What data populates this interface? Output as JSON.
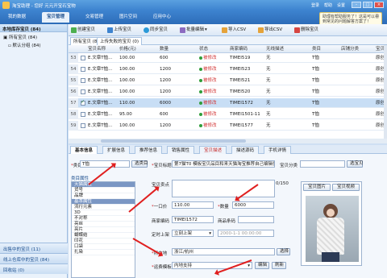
{
  "window": {
    "title": "淘宝助理 - 您好 元元开宝石宝物",
    "top_links": [
      "登录",
      "帮助",
      "设置"
    ]
  },
  "nav": {
    "tabs": [
      "我的数据",
      "宝贝管理",
      "交易管理",
      "图片空间",
      "应用中心"
    ],
    "active": 1
  },
  "sidebar": {
    "header": "本地库存宝贝 (84)",
    "items": [
      "所有宝贝 (84)",
      "默认分组 (84)"
    ],
    "footer": [
      "出售中的宝贝 (11)",
      "线上仓库中的宝贝 (84)",
      "回收站 (0)"
    ]
  },
  "toolbar": {
    "buttons": [
      "创建宝贝",
      "上传宝贝",
      "同步宝贝",
      "批量编辑",
      "导入CSV",
      "导出CSV",
      "删除宝贝"
    ]
  },
  "subtabs": [
    "所有宝贝 (84)",
    "上传失败的宝贝 (0)"
  ],
  "grid": {
    "columns": [
      "宝贝名称",
      "价格(元)",
      "数量",
      "状态",
      "商家编码",
      "无线描述",
      "类目",
      "店铺分类",
      "宝贝"
    ],
    "rows": [
      {
        "num": "53",
        "name": "E.文章T恤...",
        "price": "100.00",
        "qty": "600",
        "status": "被修改",
        "code": "TIMEI519",
        "wireless": "无",
        "cat": "T恤",
        "shopcat": "",
        "last": "原创",
        "checked": false,
        "selected": false
      },
      {
        "num": "54",
        "name": "E.文章T恤...",
        "price": "100.00",
        "qty": "1200",
        "status": "被修改",
        "code": "TIMEI523",
        "wireless": "无",
        "cat": "T恤",
        "shopcat": "",
        "last": "原创",
        "checked": false,
        "selected": false
      },
      {
        "num": "55",
        "name": "E.文章T恤...",
        "price": "100.00",
        "qty": "1200",
        "status": "被修改",
        "code": "TIMEI521",
        "wireless": "无",
        "cat": "T恤",
        "shopcat": "",
        "last": "原创",
        "checked": false,
        "selected": false
      },
      {
        "num": "56",
        "name": "E.文章T恤...",
        "price": "100.00",
        "qty": "1200",
        "status": "被修改",
        "code": "TIMEI520",
        "wireless": "无",
        "cat": "T恤",
        "shopcat": "",
        "last": "原创",
        "checked": false,
        "selected": false
      },
      {
        "num": "57",
        "name": "E.文章T恤...",
        "price": "110.00",
        "qty": "6000",
        "status": "被修改",
        "code": "TIMEI1572",
        "wireless": "无",
        "cat": "T恤",
        "shopcat": "",
        "last": "原创",
        "checked": true,
        "selected": true
      },
      {
        "num": "58",
        "name": "E.文章T恤...",
        "price": "95.00",
        "qty": "600",
        "status": "被修改",
        "code": "TIMEI1501-11",
        "wireless": "无",
        "cat": "T恤",
        "shopcat": "",
        "last": "原创",
        "checked": false,
        "selected": false
      },
      {
        "num": "59",
        "name": "E.文章T恤...",
        "price": "100.00",
        "qty": "1200",
        "status": "被修改",
        "code": "TIMEI1577",
        "wireless": "无",
        "cat": "T恤",
        "shopcat": "",
        "last": "原创",
        "checked": false,
        "selected": false
      }
    ]
  },
  "detail_tabs": [
    "基本信息",
    "扩展信息",
    "推荐信息",
    "销售属性",
    "宝贝描述",
    "描述源码",
    "手机详情"
  ],
  "detail": {
    "type_label": "类目",
    "type_value": "T恤",
    "select_btn": "选类目",
    "title_label": "宝贝标题",
    "title_value": "第7猫T0 模板宝贝品目和来天猫淘宝推荐自己编辑优化 51/60",
    "shopcat_label": "宝贝分类",
    "shopcat_btn": "选宝贝",
    "attr_header": "类目属性",
    "attr_items": [
      "天猫属性",
      "货号",
      "品牌",
      "基本属性",
      "流行元素",
      "3D",
      "不对称",
      "亮丝",
      "亮片",
      "蝴蝶结",
      "印花",
      "口袋",
      "扎染"
    ],
    "sellpoint_label": "宝贝卖点",
    "sellpoint_count": "0/150",
    "price_label": "一口价",
    "price_value": "110.00",
    "qty_label": "数量",
    "qty_value": "6000",
    "code_label": "商家编码",
    "code_value": "TIMEI1572",
    "barcode_label": "商品条码",
    "listing_label": "定时上架",
    "listing_value": "立刻上架",
    "listing_date": "2000-1-1 00:00:00",
    "location_label": "所在地",
    "location_value": "浙江/杭州",
    "location_btn": "选择",
    "shipping_label": "运费模板",
    "shipping_value": "内地支持",
    "edit_btn": "编辑",
    "refresh_btn": "刷新",
    "photo_tabs": [
      "宝贝图片",
      "宝贝视频"
    ]
  },
  "popup": {
    "text": "助理有帮助服务了！这是可以看到常见的问题解答方案了！"
  }
}
